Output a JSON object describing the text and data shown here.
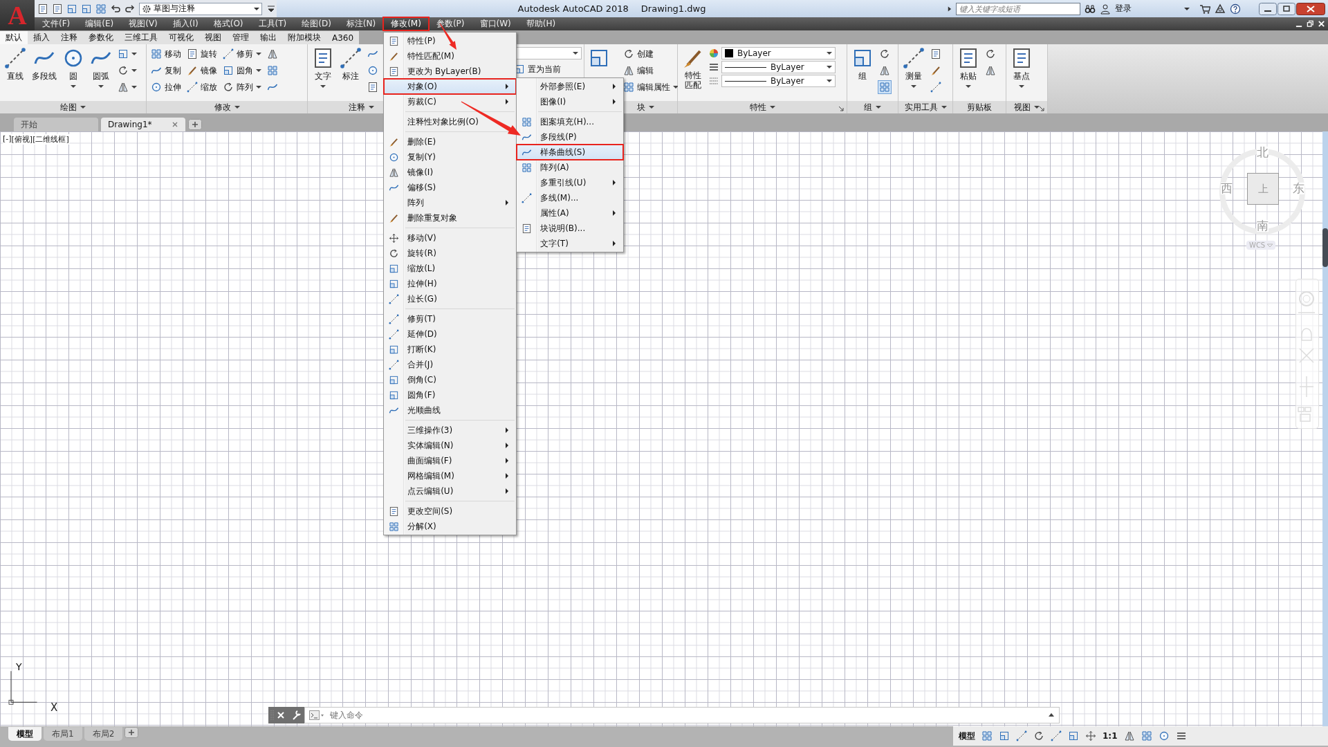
{
  "title_bar": {
    "logo": "A",
    "workspace": "草图与注释",
    "app_title": "Autodesk AutoCAD 2018",
    "file_name": "Drawing1.dwg",
    "search": {
      "placeholder": "键入关键字或短语"
    },
    "sign_in": "登录"
  },
  "menu_bar": [
    {
      "label": "文件(F)",
      "selected": false,
      "callout": false
    },
    {
      "label": "编辑(E)",
      "selected": false,
      "callout": false
    },
    {
      "label": "视图(V)",
      "selected": false,
      "callout": false
    },
    {
      "label": "插入(I)",
      "selected": false,
      "callout": false
    },
    {
      "label": "格式(O)",
      "selected": false,
      "callout": false
    },
    {
      "label": "工具(T)",
      "selected": false,
      "callout": false
    },
    {
      "label": "绘图(D)",
      "selected": false,
      "callout": false
    },
    {
      "label": "标注(N)",
      "selected": false,
      "callout": false
    },
    {
      "label": "修改(M)",
      "selected": true,
      "callout": true,
      "items": [
        {
          "kind": "item",
          "label": "特性(P)",
          "icon": true,
          "submenu": false,
          "selected": false,
          "callout": false
        },
        {
          "kind": "item",
          "label": "特性匹配(M)",
          "icon": true,
          "submenu": false,
          "selected": false,
          "callout": false
        },
        {
          "kind": "item",
          "label": "更改为 ByLayer(B)",
          "icon": true,
          "submenu": false,
          "selected": false,
          "callout": false
        },
        {
          "kind": "item",
          "label": "对象(O)",
          "icon": false,
          "submenu": true,
          "selected": true,
          "callout": true,
          "items": [
            {
              "kind": "item",
              "label": "外部参照(E)",
              "icon": false,
              "submenu": true,
              "selected": false,
              "callout": false
            },
            {
              "kind": "item",
              "label": "图像(I)",
              "icon": false,
              "submenu": true,
              "selected": false,
              "callout": false
            },
            {
              "kind": "separator"
            },
            {
              "kind": "item",
              "label": "图案填充(H)...",
              "icon": true,
              "submenu": false,
              "selected": false,
              "callout": false
            },
            {
              "kind": "item",
              "label": "多段线(P)",
              "icon": true,
              "submenu": false,
              "selected": false,
              "callout": false
            },
            {
              "kind": "item",
              "label": "样条曲线(S)",
              "icon": true,
              "submenu": false,
              "selected": true,
              "callout": true
            },
            {
              "kind": "item",
              "label": "阵列(A)",
              "icon": true,
              "submenu": false,
              "selected": false,
              "callout": false
            },
            {
              "kind": "item",
              "label": "多重引线(U)",
              "icon": false,
              "submenu": true,
              "selected": false,
              "callout": false
            },
            {
              "kind": "item",
              "label": "多线(M)...",
              "icon": true,
              "submenu": false,
              "selected": false,
              "callout": false
            },
            {
              "kind": "item",
              "label": "属性(A)",
              "icon": false,
              "submenu": true,
              "selected": false,
              "callout": false
            },
            {
              "kind": "item",
              "label": "块说明(B)...",
              "icon": true,
              "submenu": false,
              "selected": false,
              "callout": false
            },
            {
              "kind": "item",
              "label": "文字(T)",
              "icon": false,
              "submenu": true,
              "selected": false,
              "callout": false
            }
          ]
        },
        {
          "kind": "item",
          "label": "剪裁(C)",
          "icon": false,
          "submenu": true,
          "selected": false,
          "callout": false
        },
        {
          "kind": "separator"
        },
        {
          "kind": "item",
          "label": "注释性对象比例(O)",
          "icon": false,
          "submenu": false,
          "selected": false,
          "callout": false
        },
        {
          "kind": "separator"
        },
        {
          "kind": "item",
          "label": "删除(E)",
          "icon": true,
          "submenu": false,
          "selected": false,
          "callout": false
        },
        {
          "kind": "item",
          "label": "复制(Y)",
          "icon": true,
          "submenu": false,
          "selected": false,
          "callout": false
        },
        {
          "kind": "item",
          "label": "镜像(I)",
          "icon": true,
          "submenu": false,
          "selected": false,
          "callout": false
        },
        {
          "kind": "item",
          "label": "偏移(S)",
          "icon": true,
          "submenu": false,
          "selected": false,
          "callout": false
        },
        {
          "kind": "item",
          "label": "阵列",
          "icon": false,
          "submenu": true,
          "selected": false,
          "callout": false
        },
        {
          "kind": "item",
          "label": "删除重复对象",
          "icon": true,
          "submenu": false,
          "selected": false,
          "callout": false
        },
        {
          "kind": "separator"
        },
        {
          "kind": "item",
          "label": "移动(V)",
          "icon": true,
          "submenu": false,
          "selected": false,
          "callout": false
        },
        {
          "kind": "item",
          "label": "旋转(R)",
          "icon": true,
          "submenu": false,
          "selected": false,
          "callout": false
        },
        {
          "kind": "item",
          "label": "缩放(L)",
          "icon": true,
          "submenu": false,
          "selected": false,
          "callout": false
        },
        {
          "kind": "item",
          "label": "拉伸(H)",
          "icon": true,
          "submenu": false,
          "selected": false,
          "callout": false
        },
        {
          "kind": "item",
          "label": "拉长(G)",
          "icon": true,
          "submenu": false,
          "selected": false,
          "callout": false
        },
        {
          "kind": "separator"
        },
        {
          "kind": "item",
          "label": "修剪(T)",
          "icon": true,
          "submenu": false,
          "selected": false,
          "callout": false
        },
        {
          "kind": "item",
          "label": "延伸(D)",
          "icon": true,
          "submenu": false,
          "selected": false,
          "callout": false
        },
        {
          "kind": "item",
          "label": "打断(K)",
          "icon": true,
          "submenu": false,
          "selected": false,
          "callout": false
        },
        {
          "kind": "item",
          "label": "合并(J)",
          "icon": true,
          "submenu": false,
          "selected": false,
          "callout": false
        },
        {
          "kind": "item",
          "label": "倒角(C)",
          "icon": true,
          "submenu": false,
          "selected": false,
          "callout": false
        },
        {
          "kind": "item",
          "label": "圆角(F)",
          "icon": true,
          "submenu": false,
          "selected": false,
          "callout": false
        },
        {
          "kind": "item",
          "label": "光顺曲线",
          "icon": true,
          "submenu": false,
          "selected": false,
          "callout": false
        },
        {
          "kind": "separator"
        },
        {
          "kind": "item",
          "label": "三维操作(3)",
          "icon": false,
          "submenu": true,
          "selected": false,
          "callout": false
        },
        {
          "kind": "item",
          "label": "实体编辑(N)",
          "icon": false,
          "submenu": true,
          "selected": false,
          "callout": false
        },
        {
          "kind": "item",
          "label": "曲面编辑(F)",
          "icon": false,
          "submenu": true,
          "selected": false,
          "callout": false
        },
        {
          "kind": "item",
          "label": "网格编辑(M)",
          "icon": false,
          "submenu": true,
          "selected": false,
          "callout": false
        },
        {
          "kind": "item",
          "label": "点云编辑(U)",
          "icon": false,
          "submenu": true,
          "selected": false,
          "callout": false
        },
        {
          "kind": "separator"
        },
        {
          "kind": "item",
          "label": "更改空间(S)",
          "icon": true,
          "submenu": false,
          "selected": false,
          "callout": false
        },
        {
          "kind": "item",
          "label": "分解(X)",
          "icon": true,
          "submenu": false,
          "selected": false,
          "callout": false
        }
      ]
    },
    {
      "label": "参数(P)",
      "selected": false,
      "callout": false
    },
    {
      "label": "窗口(W)",
      "selected": false,
      "callout": false
    },
    {
      "label": "帮助(H)",
      "selected": false,
      "callout": false
    }
  ],
  "ribbon_tabs": [
    {
      "label": "默认",
      "selected": true
    },
    {
      "label": "插入",
      "selected": false
    },
    {
      "label": "注释",
      "selected": false
    },
    {
      "label": "参数化",
      "selected": false
    },
    {
      "label": "三维工具",
      "selected": false
    },
    {
      "label": "可视化",
      "selected": false
    },
    {
      "label": "视图",
      "selected": false
    },
    {
      "label": "管理",
      "selected": false
    },
    {
      "label": "输出",
      "selected": false
    },
    {
      "label": "附加模块",
      "selected": false
    },
    {
      "label": "A360",
      "selected": false
    }
  ],
  "ribbon_panels": [
    {
      "label": "绘图",
      "dropdown": true,
      "launcher": false,
      "tools": [
        {
          "kind": "large",
          "label": "直线",
          "dropdown": false
        },
        {
          "kind": "large",
          "label": "多段线",
          "dropdown": false
        },
        {
          "kind": "large",
          "label": "圆",
          "dropdown": true
        },
        {
          "kind": "large",
          "label": "圆弧",
          "dropdown": true
        },
        {
          "kind": "stack",
          "rows": [
            {
              "dropdown": true
            },
            {
              "dropdown": true
            },
            {
              "dropdown": true
            }
          ]
        }
      ]
    },
    {
      "label": "修改",
      "dropdown": true,
      "launcher": false,
      "tools": [
        {
          "kind": "stack",
          "rows": [
            {
              "label": "移动",
              "dropdown": false
            },
            {
              "label": "复制",
              "dropdown": false
            },
            {
              "label": "拉伸",
              "dropdown": false
            }
          ]
        },
        {
          "kind": "stack",
          "rows": [
            {
              "label": "旋转",
              "dropdown": false
            },
            {
              "label": "镜像",
              "dropdown": false
            },
            {
              "label": "缩放",
              "dropdown": false
            }
          ]
        },
        {
          "kind": "stack",
          "rows": [
            {
              "label": "修剪",
              "dropdown": true
            },
            {
              "label": "圆角",
              "dropdown": true
            },
            {
              "label": "阵列",
              "dropdown": true
            }
          ]
        },
        {
          "kind": "stack",
          "rows": [
            {
              "dropdown": false
            },
            {
              "dropdown": false
            },
            {
              "dropdown": false
            }
          ]
        }
      ]
    },
    {
      "label": "注释",
      "dropdown": true,
      "launcher": false,
      "tools": [
        {
          "kind": "large",
          "label": "文字",
          "dropdown": true
        },
        {
          "kind": "large",
          "label": "标注",
          "dropdown": false
        },
        {
          "kind": "stack",
          "rows": [
            {
              "dropdown": false
            },
            {
              "dropdown": false
            },
            {
              "dropdown": false
            }
          ]
        }
      ]
    },
    {
      "tools": [
        {
          "kind": "layer",
          "current_label": "置为当前"
        }
      ]
    },
    {
      "label": "块",
      "dropdown": true,
      "launcher": false,
      "tools": [
        {
          "kind": "large",
          "dropdown": false
        },
        {
          "kind": "stack",
          "rows": [
            {
              "label": "创建",
              "dropdown": false
            },
            {
              "label": "编辑",
              "dropdown": false
            },
            {
              "label": "编辑属性",
              "dropdown": true
            }
          ]
        }
      ]
    },
    {
      "label": "特性",
      "dropdown": true,
      "launcher": true,
      "tools": [
        {
          "kind": "large",
          "label": "特性匹配",
          "dropdown": false
        },
        {
          "kind": "properties",
          "rows": [
            {
              "kind": "color",
              "value": "ByLayer"
            },
            {
              "kind": "linetype",
              "value": "ByLayer"
            },
            {
              "kind": "lineweight",
              "value": "ByLayer"
            }
          ]
        }
      ]
    },
    {
      "label": "组",
      "dropdown": true,
      "launcher": false,
      "tools": [
        {
          "kind": "large",
          "label": "组",
          "dropdown": false
        },
        {
          "kind": "stack",
          "rows": [
            {
              "dropdown": false,
              "selected": false
            },
            {
              "dropdown": false,
              "selected": false
            },
            {
              "dropdown": false,
              "selected": true
            }
          ]
        }
      ]
    },
    {
      "label": "实用工具",
      "dropdown": true,
      "launcher": false,
      "tools": [
        {
          "kind": "large",
          "label": "测量",
          "dropdown": true
        },
        {
          "kind": "stack",
          "rows": [
            {
              "dropdown": false
            },
            {
              "dropdown": false
            },
            {
              "dropdown": false
            }
          ]
        }
      ]
    },
    {
      "label": "剪贴板",
      "dropdown": false,
      "launcher": false,
      "tools": [
        {
          "kind": "large",
          "label": "粘贴",
          "dropdown": true
        },
        {
          "kind": "stack",
          "rows": [
            {
              "dropdown": false
            },
            {
              "dropdown": false
            }
          ]
        }
      ]
    },
    {
      "label": "视图",
      "dropdown": true,
      "launcher": true,
      "tools": [
        {
          "kind": "large",
          "label": "基点",
          "dropdown": true
        }
      ]
    }
  ],
  "document_tabs": [
    {
      "label": "开始",
      "selected": false,
      "closable": false
    },
    {
      "label": "Drawing1*",
      "selected": true,
      "closable": true
    }
  ],
  "viewport_controls": [
    "[-]",
    "[俯视]",
    "[二维线框]"
  ],
  "viewcube": {
    "north": "北",
    "south": "南",
    "east": "东",
    "west": "西",
    "face": "上",
    "ucs": "WCS"
  },
  "ucs_icon": {
    "y_label": "Y",
    "x_label": "X"
  },
  "command_line": {
    "placeholder": "键入命令"
  },
  "layout_tabs": [
    {
      "label": "模型",
      "selected": true
    },
    {
      "label": "布局1",
      "selected": false
    },
    {
      "label": "布局2",
      "selected": false
    }
  ],
  "status_bar": {
    "space": "模型",
    "scale": "1:1"
  }
}
